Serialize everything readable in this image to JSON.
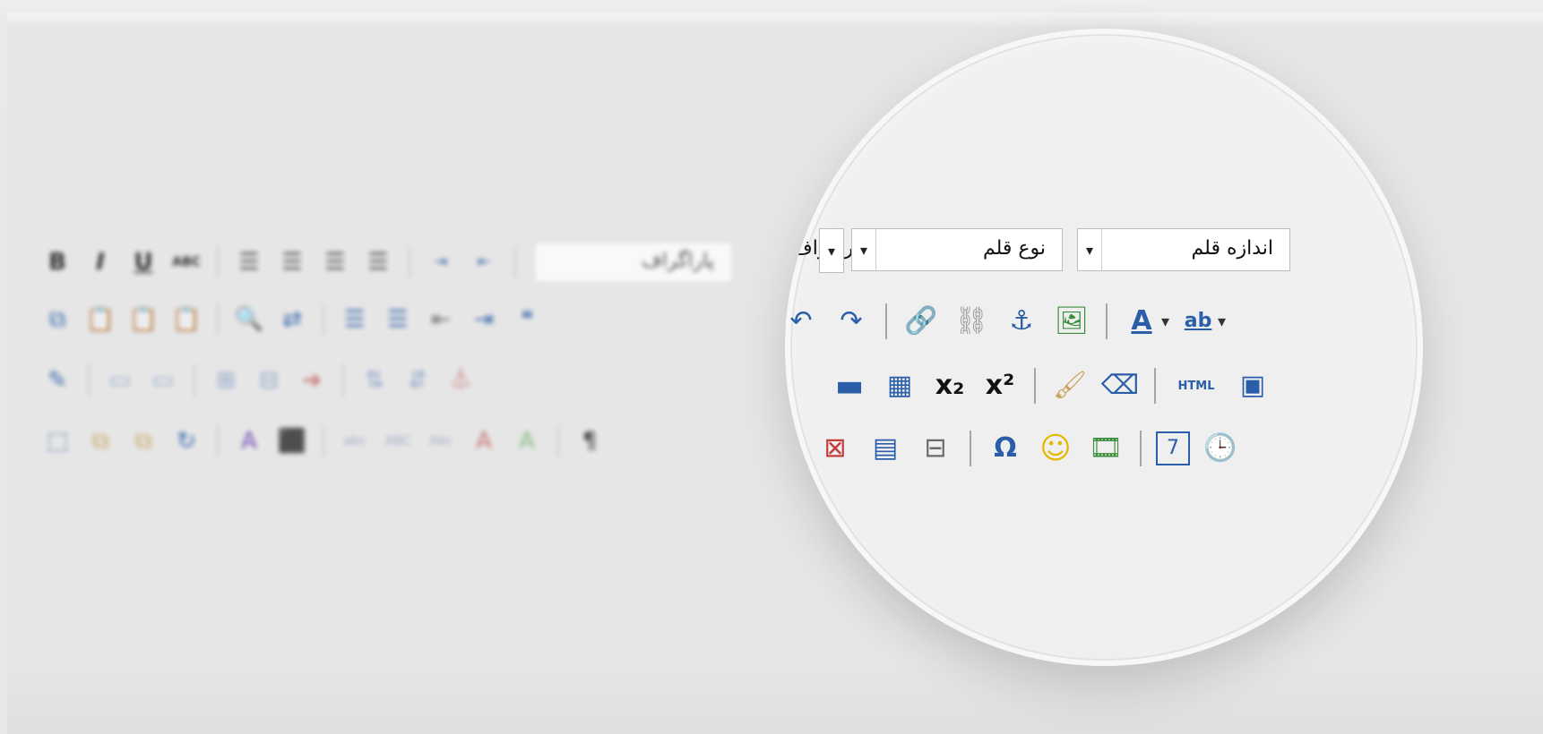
{
  "toolbar": {
    "row1": {
      "format_label": "B",
      "italic_label": "I",
      "underline_label": "U",
      "strike_label": "ABC",
      "paragraph_dropdown": "پاراگراف",
      "font_type_dropdown": "نوع قلم",
      "font_size_dropdown": "اندازه قلم"
    },
    "row2": {
      "link_icon": "link-icon",
      "unlink_icon": "unlink-icon",
      "anchor_icon": "anchor-icon",
      "image_icon": "image-icon",
      "font_color_label": "A",
      "highlight_label": "ab"
    },
    "row3": {
      "hr_icon": "horizontal-rule-icon",
      "table_icon": "table-icon",
      "subscript_label": "x₂",
      "superscript_label": "x²",
      "html_label": "HTML"
    },
    "row4": {
      "omega_label": "Ω",
      "smiley_label": "☺",
      "calendar_label": "7"
    }
  },
  "colors": {
    "accent_blue": "#2a5ea8",
    "highlight_yellow": "#d9c95b"
  }
}
